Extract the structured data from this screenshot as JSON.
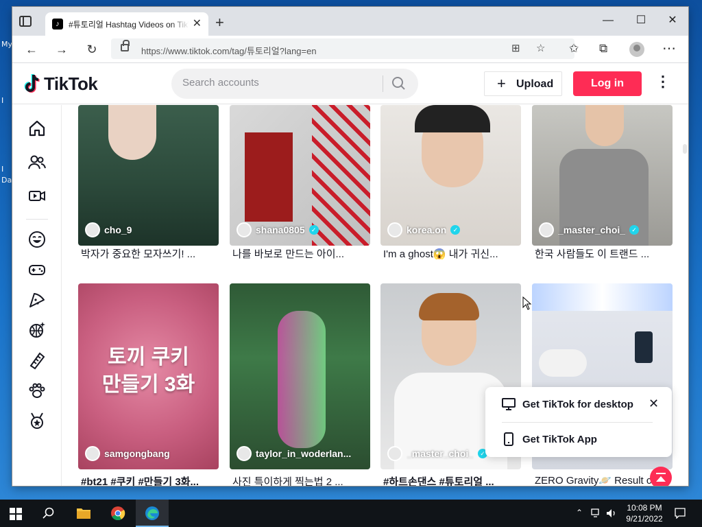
{
  "desktop": {
    "labels": [
      "My",
      "I",
      "I",
      "Da"
    ]
  },
  "browser": {
    "tab_title": "#튜토리얼 Hashtag Videos on TikTok",
    "tab_close": "✕",
    "new_tab": "+",
    "url": "https://www.tiktok.com/tag/튜토리얼?lang=en",
    "win_minimize": "—",
    "win_maximize": "☐",
    "win_close": "✕",
    "back": "←",
    "forward": "→",
    "reload": "↻",
    "menu": "⋯"
  },
  "tiktok": {
    "logo_text": "TikTok",
    "search_placeholder": "Search accounts",
    "upload_label": "Upload",
    "upload_plus": "+",
    "login_label": "Log in",
    "more": "⋮"
  },
  "videos": [
    {
      "author": "cho_9",
      "verified": false,
      "caption": "박자가 중요한 모자쓰기! ...",
      "bold": false
    },
    {
      "author": "shana0805",
      "verified": true,
      "caption": "나를 바보로 만드는 아이...",
      "bold": false
    },
    {
      "author": "korea.on",
      "verified": true,
      "caption": "I'm a ghost😱 내가 귀신...",
      "bold": false
    },
    {
      "author": "_master_choi_",
      "verified": true,
      "caption": "한국 사람들도 이 트랜드 ...",
      "bold": false
    },
    {
      "author": "samgongbang",
      "verified": false,
      "caption": "#bt21 #쿠키 #만들기 3화...",
      "bold": true,
      "overlay": [
        "토끼 쿠키",
        "만들기 3화"
      ]
    },
    {
      "author": "taylor_in_woderlan...",
      "verified": false,
      "caption": "사진 특이하게 찍는법 2 ...",
      "bold": false
    },
    {
      "author": "_master_choi_",
      "verified": true,
      "caption": "#하트손댄스 #튜토리얼 ...",
      "bold": true
    },
    {
      "author": "",
      "verified": false,
      "caption": "ZERO Gravity🪐 Result c...",
      "bold": false
    }
  ],
  "popup": {
    "desktop_label": "Get TikTok for desktop",
    "app_label": "Get TikTok App",
    "close": "✕"
  },
  "taskbar": {
    "time": "10:08 PM",
    "date": "9/21/2022"
  },
  "colors": {
    "brand_red": "#fe2c55",
    "verified": "#20d5ec",
    "text": "#161823"
  }
}
